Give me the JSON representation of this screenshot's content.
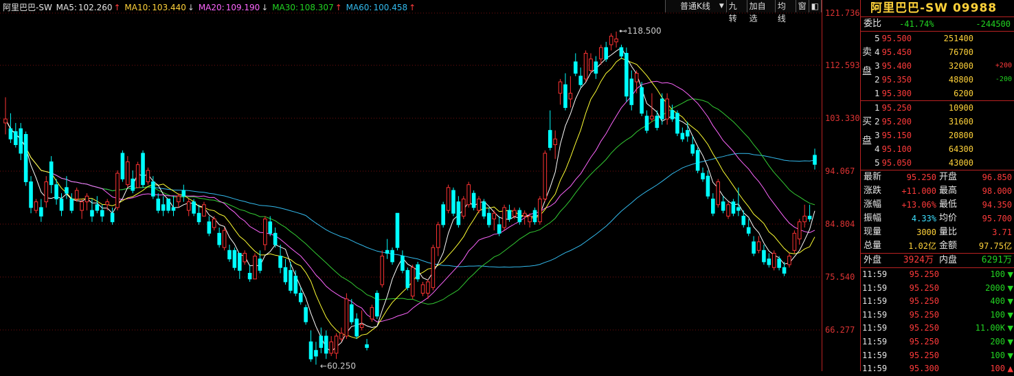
{
  "legend": {
    "name": "阿里巴巴-SW",
    "ma5_label": "MA5:",
    "ma5_value": "102.260",
    "ma5_dir": "↑",
    "ma10_label": "MA10:",
    "ma10_value": "103.440",
    "ma10_dir": "↓",
    "ma20_label": "MA20:",
    "ma20_value": "109.190",
    "ma20_dir": "↓",
    "ma30_label": "MA30:",
    "ma30_value": "108.307",
    "ma30_dir": "↑",
    "ma60_label": "MA60:",
    "ma60_value": "100.458",
    "ma60_dir": "↑"
  },
  "toolbar": {
    "kline_type": "普通K线",
    "dropdown_arrow": "▼",
    "nine_turn": "九转",
    "add_watch": "加自选",
    "avg_line": "均线",
    "window": "窗",
    "pin": "◧"
  },
  "chart_data": {
    "type": "candlestick",
    "y_ticks": [
      "121.736",
      "112.593",
      "103.330",
      "94.067",
      "84.804",
      "75.540",
      "66.277"
    ],
    "y_tick_values": [
      121.736,
      112.593,
      103.33,
      94.067,
      84.804,
      75.54,
      66.277
    ],
    "annotations": [
      {
        "text": "118.500",
        "marker": "⊷"
      },
      {
        "text": "60.250",
        "marker": "←"
      }
    ],
    "ma_colors": {
      "ma5": "#ffffff",
      "ma10": "#ffff33",
      "ma20": "#ff66ff",
      "ma30": "#33cc33",
      "ma60": "#33bbee"
    },
    "up_color": "#ff3333",
    "down_color": "#00ffff",
    "candles": [
      {
        "o": 102.5,
        "h": 107.0,
        "l": 100.5,
        "c": 103.2
      },
      {
        "o": 101.5,
        "h": 104.2,
        "l": 99.0,
        "c": 99.7
      },
      {
        "o": 101.0,
        "h": 102.5,
        "l": 98.2,
        "c": 98.7
      },
      {
        "o": 101.5,
        "h": 102.5,
        "l": 96.0,
        "c": 97.2
      },
      {
        "o": 100.5,
        "h": 101.0,
        "l": 91.5,
        "c": 92.2
      },
      {
        "o": 92.2,
        "h": 93.2,
        "l": 86.7,
        "c": 87.7
      },
      {
        "o": 87.2,
        "h": 89.2,
        "l": 86.7,
        "c": 88.7
      },
      {
        "o": 87.7,
        "h": 89.2,
        "l": 85.2,
        "c": 86.2
      },
      {
        "o": 88.7,
        "h": 93.2,
        "l": 87.7,
        "c": 92.2
      },
      {
        "o": 95.7,
        "h": 96.7,
        "l": 90.2,
        "c": 91.7
      },
      {
        "o": 91.7,
        "h": 92.7,
        "l": 88.2,
        "c": 89.2
      },
      {
        "o": 89.2,
        "h": 90.2,
        "l": 86.2,
        "c": 87.2
      },
      {
        "o": 91.2,
        "h": 93.2,
        "l": 89.2,
        "c": 90.2
      },
      {
        "o": 89.2,
        "h": 90.2,
        "l": 86.7,
        "c": 87.2
      },
      {
        "o": 89.2,
        "h": 91.2,
        "l": 88.7,
        "c": 90.7
      },
      {
        "o": 87.2,
        "h": 89.2,
        "l": 85.7,
        "c": 88.7
      },
      {
        "o": 88.7,
        "h": 90.2,
        "l": 87.2,
        "c": 89.7
      },
      {
        "o": 87.2,
        "h": 89.2,
        "l": 85.2,
        "c": 86.2
      },
      {
        "o": 88.2,
        "h": 89.7,
        "l": 86.7,
        "c": 87.2
      },
      {
        "o": 87.2,
        "h": 88.2,
        "l": 85.2,
        "c": 86.2
      },
      {
        "o": 88.2,
        "h": 89.2,
        "l": 87.2,
        "c": 88.7
      },
      {
        "o": 86.7,
        "h": 87.7,
        "l": 84.7,
        "c": 85.2
      },
      {
        "o": 87.7,
        "h": 94.2,
        "l": 87.2,
        "c": 93.7
      },
      {
        "o": 97.2,
        "h": 97.7,
        "l": 92.2,
        "c": 92.7
      },
      {
        "o": 91.7,
        "h": 96.7,
        "l": 91.2,
        "c": 95.7
      },
      {
        "o": 92.7,
        "h": 94.2,
        "l": 90.2,
        "c": 90.7
      },
      {
        "o": 91.2,
        "h": 95.7,
        "l": 91.2,
        "c": 95.2
      },
      {
        "o": 97.2,
        "h": 97.7,
        "l": 91.2,
        "c": 91.7
      },
      {
        "o": 92.2,
        "h": 94.7,
        "l": 91.7,
        "c": 94.2
      },
      {
        "o": 92.2,
        "h": 93.2,
        "l": 89.2,
        "c": 89.7
      },
      {
        "o": 89.2,
        "h": 90.2,
        "l": 86.7,
        "c": 87.2
      },
      {
        "o": 88.2,
        "h": 89.7,
        "l": 86.2,
        "c": 87.2
      },
      {
        "o": 89.2,
        "h": 89.2,
        "l": 86.7,
        "c": 87.2
      },
      {
        "o": 87.7,
        "h": 89.7,
        "l": 86.2,
        "c": 87.2
      },
      {
        "o": 88.7,
        "h": 90.2,
        "l": 87.7,
        "c": 89.7
      },
      {
        "o": 90.7,
        "h": 91.7,
        "l": 88.7,
        "c": 89.7
      },
      {
        "o": 87.2,
        "h": 89.2,
        "l": 86.2,
        "c": 88.7
      },
      {
        "o": 88.7,
        "h": 89.2,
        "l": 86.2,
        "c": 86.7
      },
      {
        "o": 86.7,
        "h": 88.2,
        "l": 84.7,
        "c": 85.2
      },
      {
        "o": 86.2,
        "h": 88.7,
        "l": 86.2,
        "c": 88.2
      },
      {
        "o": 85.2,
        "h": 86.2,
        "l": 82.7,
        "c": 83.2
      },
      {
        "o": 84.2,
        "h": 86.2,
        "l": 83.7,
        "c": 85.7
      },
      {
        "o": 83.2,
        "h": 84.2,
        "l": 80.7,
        "c": 81.2
      },
      {
        "o": 80.7,
        "h": 84.2,
        "l": 80.2,
        "c": 83.7
      },
      {
        "o": 80.2,
        "h": 81.2,
        "l": 78.2,
        "c": 78.7
      },
      {
        "o": 80.2,
        "h": 80.7,
        "l": 76.7,
        "c": 77.2
      },
      {
        "o": 79.7,
        "h": 79.7,
        "l": 75.2,
        "c": 76.7
      },
      {
        "o": 78.2,
        "h": 80.2,
        "l": 77.7,
        "c": 79.7
      },
      {
        "o": 76.2,
        "h": 77.7,
        "l": 74.7,
        "c": 75.2
      },
      {
        "o": 75.2,
        "h": 79.7,
        "l": 75.2,
        "c": 79.2
      },
      {
        "o": 78.7,
        "h": 80.2,
        "l": 76.2,
        "c": 76.7
      },
      {
        "o": 81.2,
        "h": 86.2,
        "l": 80.2,
        "c": 85.7
      },
      {
        "o": 85.2,
        "h": 86.2,
        "l": 82.7,
        "c": 83.2
      },
      {
        "o": 83.2,
        "h": 84.2,
        "l": 80.7,
        "c": 81.2
      },
      {
        "o": 79.2,
        "h": 81.2,
        "l": 76.2,
        "c": 77.2
      },
      {
        "o": 77.2,
        "h": 78.7,
        "l": 74.2,
        "c": 74.7
      },
      {
        "o": 76.7,
        "h": 78.2,
        "l": 72.7,
        "c": 73.2
      },
      {
        "o": 75.7,
        "h": 76.7,
        "l": 72.2,
        "c": 72.7
      },
      {
        "o": 72.7,
        "h": 73.7,
        "l": 70.7,
        "c": 71.2
      },
      {
        "o": 70.2,
        "h": 70.7,
        "l": 67.2,
        "c": 67.7
      },
      {
        "o": 64.2,
        "h": 66.2,
        "l": 60.7,
        "c": 61.2
      },
      {
        "o": 62.7,
        "h": 64.2,
        "l": 60.2,
        "c": 61.7
      },
      {
        "o": 65.2,
        "h": 66.7,
        "l": 62.2,
        "c": 63.2
      },
      {
        "o": 65.2,
        "h": 66.2,
        "l": 61.2,
        "c": 62.2
      },
      {
        "o": 62.2,
        "h": 65.2,
        "l": 61.7,
        "c": 64.2
      },
      {
        "o": 62.2,
        "h": 65.7,
        "l": 61.2,
        "c": 65.2
      },
      {
        "o": 64.7,
        "h": 66.7,
        "l": 64.2,
        "c": 65.7
      },
      {
        "o": 65.2,
        "h": 72.7,
        "l": 64.7,
        "c": 71.7
      },
      {
        "o": 70.7,
        "h": 71.7,
        "l": 67.2,
        "c": 67.7
      },
      {
        "o": 68.2,
        "h": 69.2,
        "l": 64.7,
        "c": 65.2
      },
      {
        "o": 66.7,
        "h": 69.7,
        "l": 66.2,
        "c": 67.2
      },
      {
        "o": 63.7,
        "h": 64.7,
        "l": 62.7,
        "c": 63.2
      },
      {
        "o": 68.2,
        "h": 70.7,
        "l": 67.7,
        "c": 70.2
      },
      {
        "o": 72.7,
        "h": 73.2,
        "l": 68.2,
        "c": 68.7
      },
      {
        "o": 74.2,
        "h": 80.2,
        "l": 73.7,
        "c": 79.2
      },
      {
        "o": 80.2,
        "h": 82.2,
        "l": 78.7,
        "c": 79.7
      },
      {
        "o": 80.2,
        "h": 80.7,
        "l": 77.7,
        "c": 78.2
      },
      {
        "o": 86.7,
        "h": 86.7,
        "l": 80.2,
        "c": 80.7
      },
      {
        "o": 79.2,
        "h": 80.2,
        "l": 76.2,
        "c": 76.7
      },
      {
        "o": 76.7,
        "h": 77.2,
        "l": 73.2,
        "c": 73.7
      },
      {
        "o": 72.2,
        "h": 77.7,
        "l": 71.7,
        "c": 77.2
      },
      {
        "o": 77.7,
        "h": 78.2,
        "l": 74.7,
        "c": 75.2
      },
      {
        "o": 72.7,
        "h": 74.7,
        "l": 72.2,
        "c": 74.2
      },
      {
        "o": 72.7,
        "h": 75.2,
        "l": 71.7,
        "c": 74.7
      },
      {
        "o": 73.7,
        "h": 81.2,
        "l": 73.2,
        "c": 80.7
      },
      {
        "o": 80.7,
        "h": 85.2,
        "l": 79.2,
        "c": 84.7
      },
      {
        "o": 88.2,
        "h": 88.7,
        "l": 84.2,
        "c": 84.7
      },
      {
        "o": 87.2,
        "h": 91.7,
        "l": 86.7,
        "c": 91.2
      },
      {
        "o": 90.7,
        "h": 91.2,
        "l": 86.2,
        "c": 86.7
      },
      {
        "o": 88.7,
        "h": 89.7,
        "l": 84.2,
        "c": 84.7
      },
      {
        "o": 86.2,
        "h": 89.7,
        "l": 85.7,
        "c": 89.2
      },
      {
        "o": 88.2,
        "h": 92.2,
        "l": 87.7,
        "c": 91.7
      },
      {
        "o": 90.2,
        "h": 90.7,
        "l": 87.2,
        "c": 87.7
      },
      {
        "o": 87.2,
        "h": 89.7,
        "l": 86.7,
        "c": 89.2
      },
      {
        "o": 88.7,
        "h": 89.2,
        "l": 85.7,
        "c": 86.2
      },
      {
        "o": 86.7,
        "h": 87.7,
        "l": 84.2,
        "c": 84.7
      },
      {
        "o": 85.7,
        "h": 87.2,
        "l": 83.7,
        "c": 86.7
      },
      {
        "o": 84.7,
        "h": 86.2,
        "l": 82.7,
        "c": 83.2
      },
      {
        "o": 84.2,
        "h": 88.2,
        "l": 83.7,
        "c": 87.7
      },
      {
        "o": 87.2,
        "h": 88.2,
        "l": 85.2,
        "c": 85.7
      },
      {
        "o": 86.2,
        "h": 87.7,
        "l": 85.7,
        "c": 87.2
      },
      {
        "o": 87.2,
        "h": 87.7,
        "l": 84.7,
        "c": 85.2
      },
      {
        "o": 86.2,
        "h": 87.2,
        "l": 84.7,
        "c": 86.7
      },
      {
        "o": 85.2,
        "h": 86.7,
        "l": 84.2,
        "c": 86.2
      },
      {
        "o": 87.2,
        "h": 87.7,
        "l": 84.7,
        "c": 85.2
      },
      {
        "o": 85.2,
        "h": 89.7,
        "l": 84.7,
        "c": 89.2
      },
      {
        "o": 89.2,
        "h": 97.7,
        "l": 88.7,
        "c": 97.2
      },
      {
        "o": 101.2,
        "h": 104.7,
        "l": 97.7,
        "c": 98.2
      },
      {
        "o": 98.7,
        "h": 101.2,
        "l": 96.2,
        "c": 99.7
      },
      {
        "o": 107.7,
        "h": 110.2,
        "l": 105.7,
        "c": 109.7
      },
      {
        "o": 109.2,
        "h": 111.2,
        "l": 104.7,
        "c": 105.2
      },
      {
        "o": 106.7,
        "h": 110.7,
        "l": 105.2,
        "c": 107.7
      },
      {
        "o": 113.2,
        "h": 114.7,
        "l": 110.7,
        "c": 111.2
      },
      {
        "o": 110.7,
        "h": 112.2,
        "l": 108.7,
        "c": 109.2
      },
      {
        "o": 110.2,
        "h": 115.2,
        "l": 109.7,
        "c": 114.7
      },
      {
        "o": 111.7,
        "h": 114.7,
        "l": 111.2,
        "c": 113.7
      },
      {
        "o": 113.2,
        "h": 114.2,
        "l": 110.2,
        "c": 111.2
      },
      {
        "o": 113.7,
        "h": 116.2,
        "l": 112.7,
        "c": 115.7
      },
      {
        "o": 115.7,
        "h": 116.7,
        "l": 113.2,
        "c": 113.7
      },
      {
        "o": 116.2,
        "h": 118.2,
        "l": 115.2,
        "c": 117.7
      },
      {
        "o": 116.7,
        "h": 118.5,
        "l": 115.7,
        "c": 117.2
      },
      {
        "o": 115.7,
        "h": 116.2,
        "l": 113.7,
        "c": 114.2
      },
      {
        "o": 114.7,
        "h": 115.7,
        "l": 106.2,
        "c": 107.2
      },
      {
        "o": 110.2,
        "h": 111.7,
        "l": 104.7,
        "c": 105.7
      },
      {
        "o": 109.7,
        "h": 111.7,
        "l": 107.7,
        "c": 111.2
      },
      {
        "o": 108.7,
        "h": 109.7,
        "l": 103.7,
        "c": 104.2
      },
      {
        "o": 103.7,
        "h": 104.7,
        "l": 100.7,
        "c": 101.2
      },
      {
        "o": 103.2,
        "h": 107.7,
        "l": 102.7,
        "c": 103.7
      },
      {
        "o": 103.7,
        "h": 104.7,
        "l": 101.2,
        "c": 101.7
      },
      {
        "o": 106.7,
        "h": 107.7,
        "l": 102.2,
        "c": 103.2
      },
      {
        "o": 103.2,
        "h": 107.7,
        "l": 102.2,
        "c": 106.7
      },
      {
        "o": 104.7,
        "h": 105.7,
        "l": 102.7,
        "c": 103.2
      },
      {
        "o": 104.2,
        "h": 104.7,
        "l": 100.2,
        "c": 100.7
      },
      {
        "o": 100.7,
        "h": 101.7,
        "l": 99.2,
        "c": 99.7
      },
      {
        "o": 101.2,
        "h": 102.7,
        "l": 99.2,
        "c": 100.2
      },
      {
        "o": 98.7,
        "h": 100.2,
        "l": 96.7,
        "c": 97.2
      },
      {
        "o": 97.7,
        "h": 98.2,
        "l": 93.7,
        "c": 94.2
      },
      {
        "o": 93.7,
        "h": 94.7,
        "l": 92.2,
        "c": 92.7
      },
      {
        "o": 93.2,
        "h": 94.2,
        "l": 89.2,
        "c": 89.7
      },
      {
        "o": 89.2,
        "h": 90.2,
        "l": 86.2,
        "c": 86.7
      },
      {
        "o": 88.2,
        "h": 92.7,
        "l": 87.7,
        "c": 92.2
      },
      {
        "o": 88.7,
        "h": 89.7,
        "l": 86.7,
        "c": 87.2
      },
      {
        "o": 86.2,
        "h": 88.7,
        "l": 85.7,
        "c": 88.2
      },
      {
        "o": 88.7,
        "h": 89.2,
        "l": 86.2,
        "c": 86.7
      },
      {
        "o": 87.7,
        "h": 91.2,
        "l": 86.2,
        "c": 87.2
      },
      {
        "o": 86.2,
        "h": 87.2,
        "l": 84.2,
        "c": 84.7
      },
      {
        "o": 84.2,
        "h": 85.7,
        "l": 82.7,
        "c": 83.2
      },
      {
        "o": 81.7,
        "h": 82.7,
        "l": 79.2,
        "c": 79.7
      },
      {
        "o": 80.2,
        "h": 82.7,
        "l": 79.7,
        "c": 81.7
      },
      {
        "o": 80.2,
        "h": 81.2,
        "l": 77.7,
        "c": 78.2
      },
      {
        "o": 78.7,
        "h": 79.7,
        "l": 77.2,
        "c": 77.7
      },
      {
        "o": 77.2,
        "h": 80.2,
        "l": 76.7,
        "c": 79.7
      },
      {
        "o": 78.7,
        "h": 79.2,
        "l": 76.7,
        "c": 77.2
      },
      {
        "o": 77.2,
        "h": 78.2,
        "l": 75.7,
        "c": 76.2
      },
      {
        "o": 77.7,
        "h": 79.7,
        "l": 77.2,
        "c": 79.2
      },
      {
        "o": 80.2,
        "h": 83.7,
        "l": 79.7,
        "c": 83.2
      },
      {
        "o": 82.2,
        "h": 85.7,
        "l": 81.2,
        "c": 85.2
      },
      {
        "o": 85.2,
        "h": 88.2,
        "l": 84.2,
        "c": 86.2
      },
      {
        "o": 86.2,
        "h": 88.2,
        "l": 85.2,
        "c": 85.7
      },
      {
        "o": 96.85,
        "h": 98.0,
        "l": 94.35,
        "c": 95.25
      }
    ]
  },
  "panel": {
    "title": "阿里巴巴-SW 09988",
    "weibi_label": "委比",
    "weibi_pct": "-41.74%",
    "weibi_diff": "-244500",
    "sell_side_label": [
      "卖",
      "盘"
    ],
    "buy_side_label": [
      "买",
      "盘"
    ],
    "sell": [
      {
        "level": "5",
        "price": "95.500",
        "volume": "251400",
        "change": ""
      },
      {
        "level": "4",
        "price": "95.450",
        "volume": "76700",
        "change": ""
      },
      {
        "level": "3",
        "price": "95.400",
        "volume": "32000",
        "change": "+200"
      },
      {
        "level": "2",
        "price": "95.350",
        "volume": "48800",
        "change": "-200"
      },
      {
        "level": "1",
        "price": "95.300",
        "volume": "6200",
        "change": ""
      }
    ],
    "buy": [
      {
        "level": "1",
        "price": "95.250",
        "volume": "10900"
      },
      {
        "level": "2",
        "price": "95.200",
        "volume": "31600"
      },
      {
        "level": "3",
        "price": "95.150",
        "volume": "20800"
      },
      {
        "level": "4",
        "price": "95.100",
        "volume": "64300"
      },
      {
        "level": "5",
        "price": "95.050",
        "volume": "43000"
      }
    ],
    "stats": [
      {
        "l1": "最新",
        "v1": "95.250",
        "l2": "开盘",
        "v2": "96.850",
        "c1": "red",
        "c2": "red"
      },
      {
        "l1": "涨跌",
        "v1": "+11.000",
        "l2": "最高",
        "v2": "98.000",
        "c1": "red",
        "c2": "red"
      },
      {
        "l1": "涨幅",
        "v1": "+13.06%",
        "l2": "最低",
        "v2": "94.350",
        "c1": "red",
        "c2": "red"
      },
      {
        "l1": "振幅",
        "v1": "4.33%",
        "l2": "均价",
        "v2": "95.700",
        "c1": "cyan",
        "c2": "red"
      },
      {
        "l1": "现量",
        "v1": "3000",
        "l2": "量比",
        "v2": "3.71",
        "c1": "yel",
        "c2": "red"
      },
      {
        "l1": "总量",
        "v1": "1.02亿",
        "l2": "金额",
        "v2": "97.75亿",
        "c1": "yel",
        "c2": "yel"
      }
    ],
    "outer_label": "外盘",
    "outer_value": "3924万",
    "inner_label": "内盘",
    "inner_value": "6291万",
    "ticks": [
      {
        "time": "11:59",
        "price": "95.250",
        "vol": "100",
        "dir": "down"
      },
      {
        "time": "11:59",
        "price": "95.250",
        "vol": "2000",
        "dir": "down"
      },
      {
        "time": "11:59",
        "price": "95.250",
        "vol": "400",
        "dir": "down"
      },
      {
        "time": "11:59",
        "price": "95.250",
        "vol": "100",
        "dir": "down"
      },
      {
        "time": "11:59",
        "price": "95.250",
        "vol": "11.00K",
        "dir": "down"
      },
      {
        "time": "11:59",
        "price": "95.250",
        "vol": "200",
        "dir": "down"
      },
      {
        "time": "11:59",
        "price": "95.250",
        "vol": "100",
        "dir": "down"
      },
      {
        "time": "11:59",
        "price": "95.300",
        "vol": "100",
        "dir": "up"
      }
    ]
  }
}
